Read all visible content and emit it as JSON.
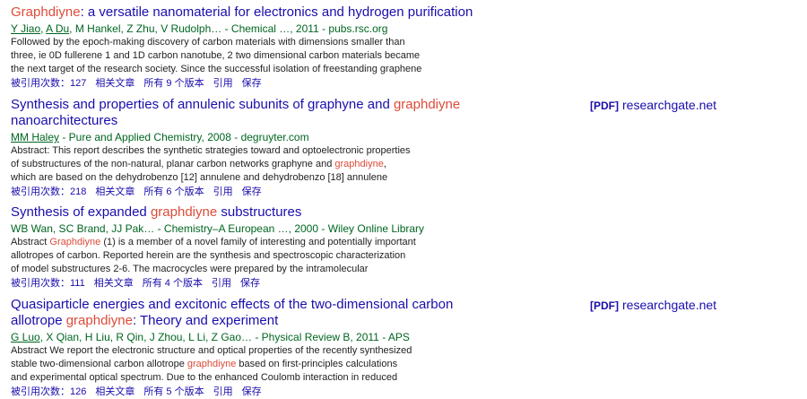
{
  "results": [
    {
      "title": [
        {
          "t": "Graphdiyne",
          "hl": true
        },
        {
          "t": ": a versatile nanomaterial for electronics and hydrogen purification",
          "hl": false
        }
      ],
      "authors_linked": [
        "Y Jiao",
        "A Du"
      ],
      "authors_rest": ", M Hankel, Z Zhu, V Rudolph… - Chemical …, 2011 - pubs.rsc.org",
      "snippet": [
        [
          {
            "t": "Followed by the epoch-making discovery of carbon materials with dimensions smaller than",
            "hl": false
          }
        ],
        [
          {
            "t": "three, ie 0D fullerene 1 and 1D carbon nanotube, 2 two dimensional carbon materials became",
            "hl": false
          }
        ],
        [
          {
            "t": "the next target of the research society. Since the successful isolation of freestanding graphene",
            "hl": false
          }
        ]
      ],
      "links": [
        "被引用次数：127",
        "相关文章",
        "所有 9 个版本",
        "引用",
        "保存"
      ],
      "pdf": null
    },
    {
      "title": [
        {
          "t": "Synthesis and properties of annulenic subunits of graphyne and ",
          "hl": false
        },
        {
          "t": "graphdiyne",
          "hl": true
        },
        {
          "t": " nanoarchitectures",
          "hl": false
        }
      ],
      "authors_linked": [
        "MM Haley"
      ],
      "authors_rest": " - Pure and Applied Chemistry, 2008 - degruyter.com",
      "snippet": [
        [
          {
            "t": "Abstract: This report describes the synthetic strategies toward and optoelectronic properties",
            "hl": false
          }
        ],
        [
          {
            "t": "of substructures of the non-natural, planar carbon networks graphyne and ",
            "hl": false
          },
          {
            "t": "graphdiyne",
            "hl": true
          },
          {
            "t": ",",
            "hl": false
          }
        ],
        [
          {
            "t": "which are based on the dehydrobenzo [12] annulene and dehydrobenzo [18] annulene",
            "hl": false
          }
        ]
      ],
      "links": [
        "被引用次数：218",
        "相关文章",
        "所有 6 个版本",
        "引用",
        "保存"
      ],
      "pdf": {
        "tag": "[PDF]",
        "site": "researchgate.net"
      }
    },
    {
      "title": [
        {
          "t": "Synthesis of expanded ",
          "hl": false
        },
        {
          "t": "graphdiyne",
          "hl": true
        },
        {
          "t": " substructures",
          "hl": false
        }
      ],
      "authors_linked": [],
      "authors_rest": "WB Wan, SC Brand, JJ Pak… - Chemistry–A European …, 2000 - Wiley Online Library",
      "snippet": [
        [
          {
            "t": "Abstract ",
            "hl": false
          },
          {
            "t": "Graphdiyne",
            "hl": true
          },
          {
            "t": " (1) is a member of a novel family of interesting and potentially important",
            "hl": false
          }
        ],
        [
          {
            "t": "allotropes of carbon. Reported herein are the synthesis and spectroscopic characterization",
            "hl": false
          }
        ],
        [
          {
            "t": "of model substructures 2-6. The macrocycles were prepared by the intramolecular",
            "hl": false
          }
        ]
      ],
      "links": [
        "被引用次数：111",
        "相关文章",
        "所有 4 个版本",
        "引用",
        "保存"
      ],
      "pdf": null
    },
    {
      "title": [
        {
          "t": "Quasiparticle energies and excitonic effects of the two-dimensional carbon allotrope ",
          "hl": false
        },
        {
          "t": "graphdiyne",
          "hl": true
        },
        {
          "t": ": Theory and experiment",
          "hl": false
        }
      ],
      "authors_linked": [
        "G Luo"
      ],
      "authors_rest": ", X Qian, H Liu, R Qin, J Zhou, L Li, Z Gao… - Physical Review B, 2011 - APS",
      "snippet": [
        [
          {
            "t": "Abstract We report the electronic structure and optical properties of the recently synthesized",
            "hl": false
          }
        ],
        [
          {
            "t": "stable two-dimensional carbon allotrope ",
            "hl": false
          },
          {
            "t": "graphdiyne",
            "hl": true
          },
          {
            "t": " based on first-principles calculations",
            "hl": false
          }
        ],
        [
          {
            "t": "and experimental optical spectrum. Due to the enhanced Coulomb interaction in reduced",
            "hl": false
          }
        ]
      ],
      "links": [
        "被引用次数：126",
        "相关文章",
        "所有 5 个版本",
        "引用",
        "保存"
      ],
      "pdf": {
        "tag": "[PDF]",
        "site": "researchgate.net"
      }
    }
  ]
}
